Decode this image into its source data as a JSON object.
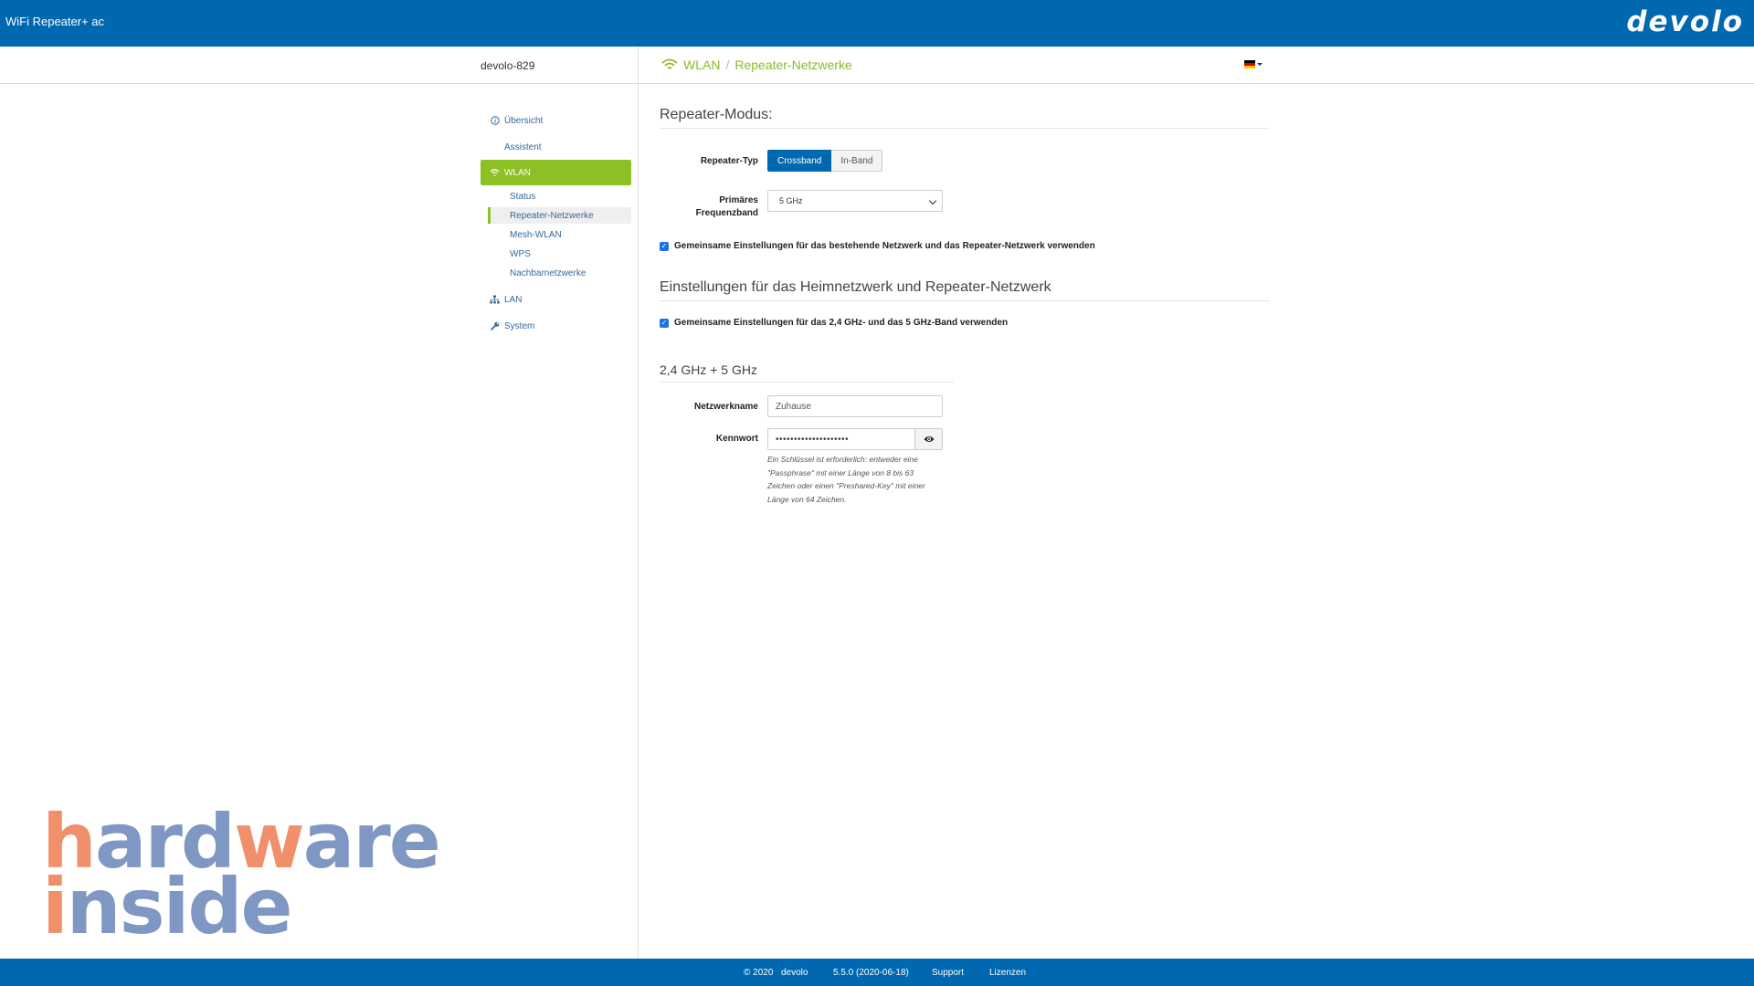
{
  "header": {
    "app_title": "WiFi Repeater+ ac",
    "brand": "devolo"
  },
  "subheader": {
    "device_name": "devolo-829",
    "breadcrumb": [
      "WLAN",
      "Repeater-Netzwerke"
    ],
    "breadcrumb_sep": "/",
    "language_flag": "de-flag-icon"
  },
  "sidebar": {
    "items": [
      {
        "label": "Übersicht",
        "icon": "info-icon"
      },
      {
        "label": "Assistent",
        "icon": ""
      },
      {
        "label": "WLAN",
        "icon": "wifi-icon"
      },
      {
        "label": "LAN",
        "icon": "network-icon"
      },
      {
        "label": "System",
        "icon": "wrench-icon"
      }
    ],
    "wlan_subitems": [
      {
        "label": "Status"
      },
      {
        "label": "Repeater-Netzwerke"
      },
      {
        "label": "Mesh-WLAN"
      },
      {
        "label": "WPS"
      },
      {
        "label": "Nachbarnetzwerke"
      }
    ]
  },
  "main": {
    "repeater_mode": {
      "title": "Repeater-Modus:",
      "type_label": "Repeater-Typ",
      "type_options": [
        "Crossband",
        "In-Band"
      ],
      "type_selected": "Crossband",
      "band_label": "Primäres Frequenzband",
      "band_value": "5 GHz",
      "shared_settings_label": "Gemeinsame Einstellungen für das bestehende Netzwerk und das Repeater-Netzwerk verwenden",
      "shared_settings_checked": true
    },
    "network_settings": {
      "title": "Einstellungen für das Heimnetzwerk und Repeater-Netzwerk",
      "shared_band_label": "Gemeinsame Einstellungen für das 2,4 GHz- und das 5 GHz-Band verwenden",
      "shared_band_checked": true,
      "band_heading": "2,4 GHz + 5 GHz",
      "ssid_label": "Netzwerkname",
      "ssid_value": "Zuhause",
      "password_label": "Kennwort",
      "password_value": "••••••••••••••••••••",
      "password_help": "Ein Schlüssel ist erforderlich: entweder eine \"Passphrase\" mit einer Länge von 8 bis 63 Zeichen oder einen \"Preshared-Key\" mit einer Länge von 64 Zeichen."
    }
  },
  "footer": {
    "copyright": "© 2020",
    "company": "devolo",
    "version": "5.5.0 (2020-06-18)",
    "support": "Support",
    "licenses": "Lizenzen"
  },
  "watermark": {
    "line1": "hardware",
    "line2": "inside"
  },
  "colors": {
    "header_blue": "#0067b1",
    "accent_green": "#8dc025",
    "link_blue": "#34699a",
    "watermark_orange": "#f0906a",
    "watermark_blue": "#7f97c3"
  }
}
